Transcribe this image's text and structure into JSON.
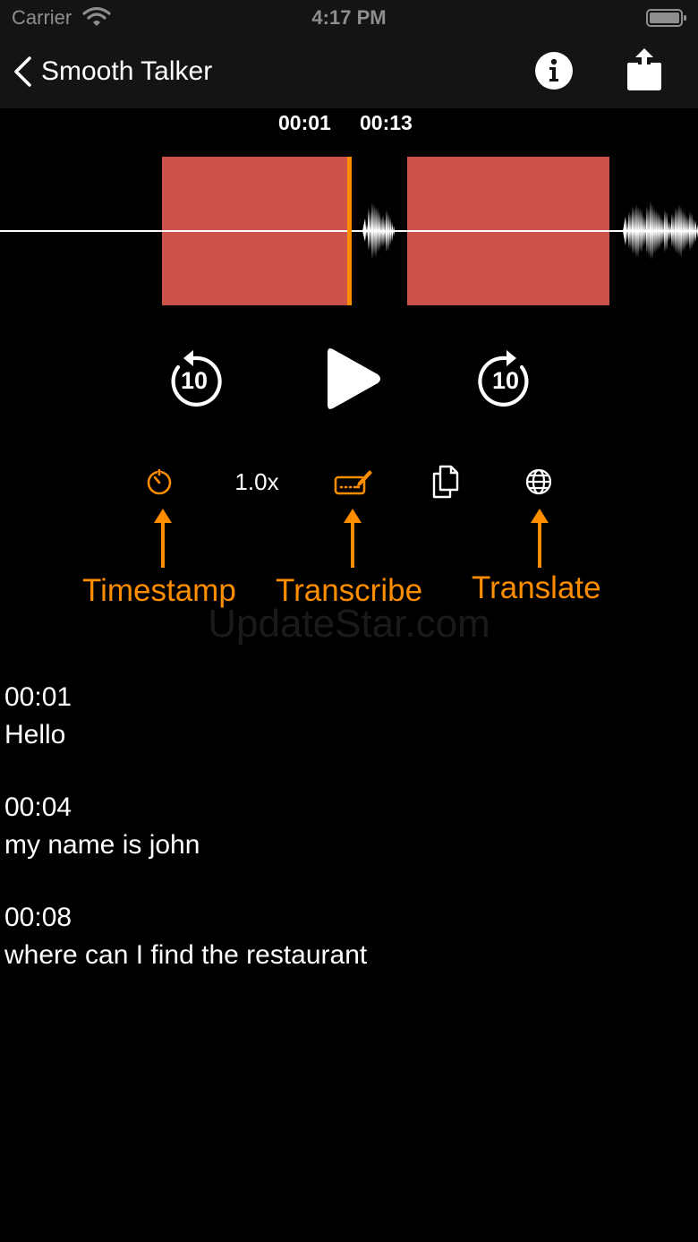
{
  "status_bar": {
    "carrier": "Carrier",
    "time": "4:17 PM"
  },
  "nav": {
    "title": "Smooth Talker",
    "back_icon": "chevron-left-icon",
    "info_icon": "info-icon",
    "share_icon": "share-icon"
  },
  "player": {
    "start_time": "00:01",
    "end_time": "00:13",
    "skip_back_label": "10",
    "skip_forward_label": "10",
    "playhead_color": "#ff8d00",
    "segment_color": "#cd5249"
  },
  "toolbar": {
    "speed": "1.0x",
    "timestamp_icon": "timer-icon",
    "transcribe_icon": "keyboard-pencil-icon",
    "copy_icon": "copy-icon",
    "translate_icon": "globe-icon"
  },
  "annotations": {
    "timestamp": "Timestamp",
    "transcribe": "Transcribe",
    "translate": "Translate",
    "color": "#ff8d00"
  },
  "watermark": "UpdateStar.com",
  "transcript": [
    {
      "time": "00:01",
      "text": "Hello"
    },
    {
      "time": "00:04",
      "text": "my name is john"
    },
    {
      "time": "00:08",
      "text": "where can I find the restaurant"
    }
  ]
}
